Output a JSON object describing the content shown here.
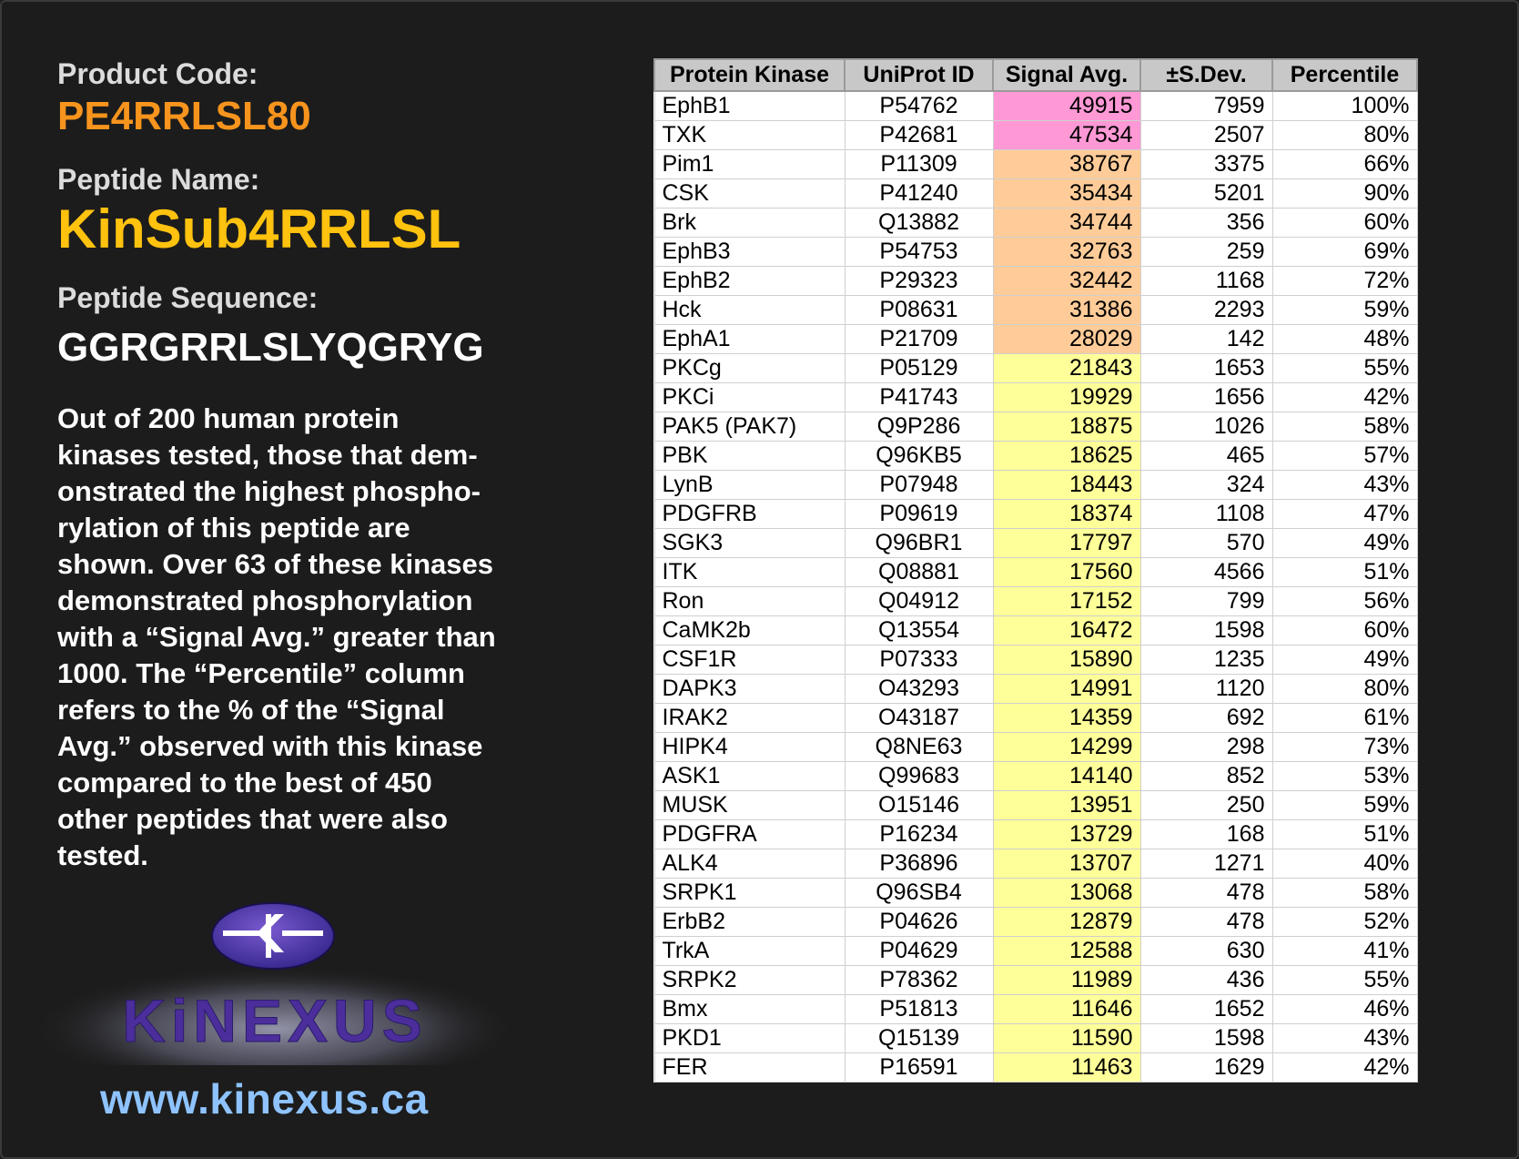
{
  "left": {
    "product_code_label": "Product Code:",
    "product_code": "PE4RRLSL80",
    "peptide_name_label": "Peptide Name:",
    "peptide_name": "KinSub4RRLSL",
    "peptide_sequence_label": "Peptide Sequence:",
    "peptide_sequence": "GGRGRRLSLYQGRYG",
    "description_lines": [
      "Out of 200 human protein",
      "kinases tested, those that dem-",
      "onstrated the highest phospho-",
      "rylation of this peptide are",
      "shown. Over 63 of these kinases",
      "demonstrated phosphorylation",
      "with a “Signal Avg.” greater than",
      "1000. The “Percentile” column",
      "refers to the % of the “Signal",
      "Avg.” observed with this kinase",
      "compared to the best of 450",
      "other peptides that were also",
      "tested."
    ],
    "logo_text": "KiNEXUS",
    "url": "www.kinexus.ca"
  },
  "colors": {
    "product_code": "#f7941d",
    "peptide_name": "#ffc20e",
    "url": "#8ec3ff",
    "highlight_pink": "#ff99d6",
    "highlight_orange": "#ffcc99",
    "highlight_yellow": "#ffff99"
  },
  "table": {
    "headers": [
      "Protein Kinase",
      "UniProt ID",
      "Signal Avg.",
      "±S.Dev.",
      "Percentile"
    ],
    "rows": [
      {
        "kinase": "EphB1",
        "uniprot": "P54762",
        "signal": "49915",
        "sdev": "7959",
        "percentile": "100%",
        "level": "pink"
      },
      {
        "kinase": "TXK",
        "uniprot": "P42681",
        "signal": "47534",
        "sdev": "2507",
        "percentile": "80%",
        "level": "pink"
      },
      {
        "kinase": "Pim1",
        "uniprot": "P11309",
        "signal": "38767",
        "sdev": "3375",
        "percentile": "66%",
        "level": "orange"
      },
      {
        "kinase": "CSK",
        "uniprot": "P41240",
        "signal": "35434",
        "sdev": "5201",
        "percentile": "90%",
        "level": "orange"
      },
      {
        "kinase": "Brk",
        "uniprot": "Q13882",
        "signal": "34744",
        "sdev": "356",
        "percentile": "60%",
        "level": "orange"
      },
      {
        "kinase": "EphB3",
        "uniprot": "P54753",
        "signal": "32763",
        "sdev": "259",
        "percentile": "69%",
        "level": "orange"
      },
      {
        "kinase": "EphB2",
        "uniprot": "P29323",
        "signal": "32442",
        "sdev": "1168",
        "percentile": "72%",
        "level": "orange"
      },
      {
        "kinase": "Hck",
        "uniprot": "P08631",
        "signal": "31386",
        "sdev": "2293",
        "percentile": "59%",
        "level": "orange"
      },
      {
        "kinase": "EphA1",
        "uniprot": "P21709",
        "signal": "28029",
        "sdev": "142",
        "percentile": "48%",
        "level": "orange"
      },
      {
        "kinase": "PKCg",
        "uniprot": "P05129",
        "signal": "21843",
        "sdev": "1653",
        "percentile": "55%",
        "level": "yellow"
      },
      {
        "kinase": "PKCi",
        "uniprot": "P41743",
        "signal": "19929",
        "sdev": "1656",
        "percentile": "42%",
        "level": "yellow"
      },
      {
        "kinase": "PAK5 (PAK7)",
        "uniprot": "Q9P286",
        "signal": "18875",
        "sdev": "1026",
        "percentile": "58%",
        "level": "yellow"
      },
      {
        "kinase": "PBK",
        "uniprot": "Q96KB5",
        "signal": "18625",
        "sdev": "465",
        "percentile": "57%",
        "level": "yellow"
      },
      {
        "kinase": "LynB",
        "uniprot": "P07948",
        "signal": "18443",
        "sdev": "324",
        "percentile": "43%",
        "level": "yellow"
      },
      {
        "kinase": "PDGFRB",
        "uniprot": "P09619",
        "signal": "18374",
        "sdev": "1108",
        "percentile": "47%",
        "level": "yellow"
      },
      {
        "kinase": "SGK3",
        "uniprot": "Q96BR1",
        "signal": "17797",
        "sdev": "570",
        "percentile": "49%",
        "level": "yellow"
      },
      {
        "kinase": "ITK",
        "uniprot": "Q08881",
        "signal": "17560",
        "sdev": "4566",
        "percentile": "51%",
        "level": "yellow"
      },
      {
        "kinase": "Ron",
        "uniprot": "Q04912",
        "signal": "17152",
        "sdev": "799",
        "percentile": "56%",
        "level": "yellow"
      },
      {
        "kinase": "CaMK2b",
        "uniprot": "Q13554",
        "signal": "16472",
        "sdev": "1598",
        "percentile": "60%",
        "level": "yellow"
      },
      {
        "kinase": "CSF1R",
        "uniprot": "P07333",
        "signal": "15890",
        "sdev": "1235",
        "percentile": "49%",
        "level": "yellow"
      },
      {
        "kinase": "DAPK3",
        "uniprot": "O43293",
        "signal": "14991",
        "sdev": "1120",
        "percentile": "80%",
        "level": "yellow"
      },
      {
        "kinase": "IRAK2",
        "uniprot": "O43187",
        "signal": "14359",
        "sdev": "692",
        "percentile": "61%",
        "level": "yellow"
      },
      {
        "kinase": "HIPK4",
        "uniprot": "Q8NE63",
        "signal": "14299",
        "sdev": "298",
        "percentile": "73%",
        "level": "yellow"
      },
      {
        "kinase": "ASK1",
        "uniprot": "Q99683",
        "signal": "14140",
        "sdev": "852",
        "percentile": "53%",
        "level": "yellow"
      },
      {
        "kinase": "MUSK",
        "uniprot": "O15146",
        "signal": "13951",
        "sdev": "250",
        "percentile": "59%",
        "level": "yellow"
      },
      {
        "kinase": "PDGFRA",
        "uniprot": "P16234",
        "signal": "13729",
        "sdev": "168",
        "percentile": "51%",
        "level": "yellow"
      },
      {
        "kinase": "ALK4",
        "uniprot": "P36896",
        "signal": "13707",
        "sdev": "1271",
        "percentile": "40%",
        "level": "yellow"
      },
      {
        "kinase": "SRPK1",
        "uniprot": "Q96SB4",
        "signal": "13068",
        "sdev": "478",
        "percentile": "58%",
        "level": "yellow"
      },
      {
        "kinase": "ErbB2",
        "uniprot": "P04626",
        "signal": "12879",
        "sdev": "478",
        "percentile": "52%",
        "level": "yellow"
      },
      {
        "kinase": "TrkA",
        "uniprot": "P04629",
        "signal": "12588",
        "sdev": "630",
        "percentile": "41%",
        "level": "yellow"
      },
      {
        "kinase": "SRPK2",
        "uniprot": "P78362",
        "signal": "11989",
        "sdev": "436",
        "percentile": "55%",
        "level": "yellow"
      },
      {
        "kinase": "Bmx",
        "uniprot": "P51813",
        "signal": "11646",
        "sdev": "1652",
        "percentile": "46%",
        "level": "yellow"
      },
      {
        "kinase": "PKD1",
        "uniprot": "Q15139",
        "signal": "11590",
        "sdev": "1598",
        "percentile": "43%",
        "level": "yellow"
      },
      {
        "kinase": "FER",
        "uniprot": "P16591",
        "signal": "11463",
        "sdev": "1629",
        "percentile": "42%",
        "level": "yellow"
      }
    ]
  }
}
